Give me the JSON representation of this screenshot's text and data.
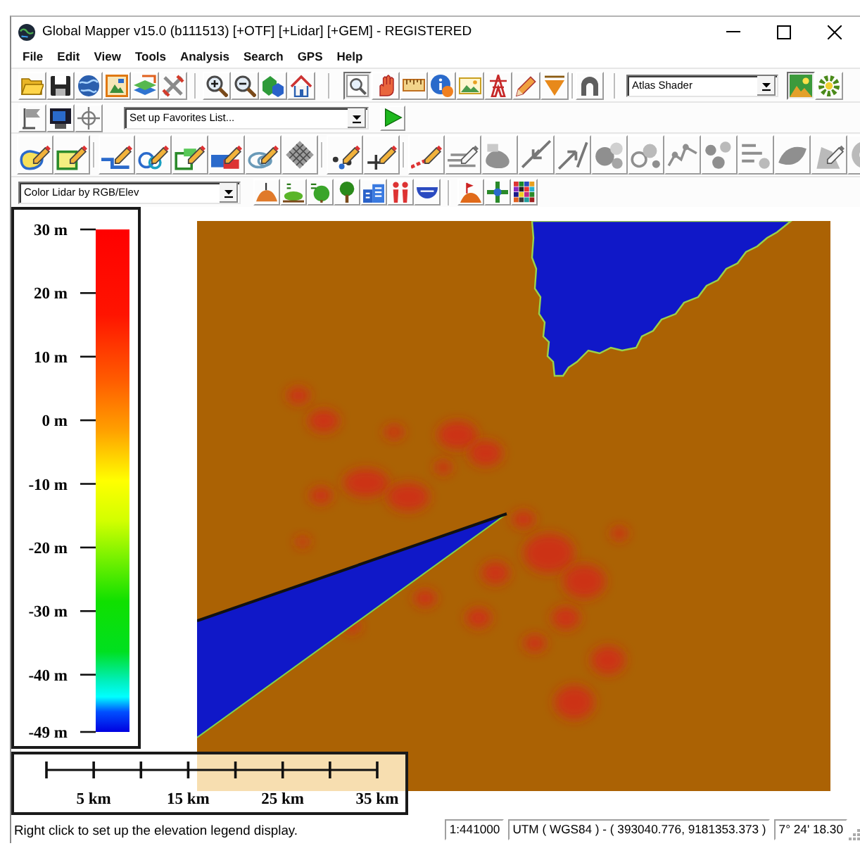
{
  "window": {
    "title": "Global Mapper v15.0 (b111513) [+OTF] [+Lidar] [+GEM] - REGISTERED"
  },
  "menu": [
    "File",
    "Edit",
    "View",
    "Tools",
    "Analysis",
    "Search",
    "GPS",
    "Help"
  ],
  "toolbar_1": {
    "groups": [
      {
        "buttons": [
          {
            "pressed": false
          },
          {
            "pressed": false
          },
          {
            "pressed": false
          },
          {
            "pressed": false
          },
          {
            "pressed": false
          },
          {
            "pressed": false
          }
        ]
      },
      {
        "buttons": [
          {
            "pressed": false
          },
          {
            "pressed": false
          },
          {
            "pressed": false
          },
          {
            "pressed": false
          }
        ]
      },
      {
        "buttons": [
          {
            "pressed": true
          },
          {
            "pressed": false
          },
          {
            "pressed": false
          },
          {
            "pressed": false
          },
          {
            "pressed": false
          },
          {
            "pressed": false
          },
          {
            "pressed": false
          },
          {
            "pressed": false
          }
        ]
      },
      {
        "buttons": [
          {
            "pressed": false
          }
        ]
      }
    ],
    "shader_select": {
      "value": "Atlas Shader"
    },
    "shader_buttons": [
      {
        "pressed": true
      },
      {
        "pressed": false
      }
    ]
  },
  "toolbar_2": {
    "buttons": [
      {
        "disabled": false
      },
      {
        "disabled": false
      },
      {
        "disabled": true
      }
    ],
    "favorites_select": {
      "value": "Set up Favorites List..."
    }
  },
  "toolbar_3": {
    "groups": [
      {
        "buttons": [
          {
            "disabled": false
          },
          {
            "disabled": false
          }
        ]
      },
      {
        "buttons": [
          {
            "disabled": false
          },
          {
            "disabled": false
          },
          {
            "disabled": false
          },
          {
            "disabled": false
          },
          {
            "disabled": false
          },
          {
            "disabled": false
          }
        ]
      },
      {
        "buttons": [
          {
            "disabled": false
          },
          {
            "disabled": false
          }
        ]
      },
      {
        "buttons": [
          {
            "disabled": false
          },
          {
            "disabled": true
          },
          {
            "disabled": true
          },
          {
            "disabled": true
          },
          {
            "disabled": true
          },
          {
            "disabled": true
          },
          {
            "disabled": true
          },
          {
            "disabled": true
          },
          {
            "disabled": true
          },
          {
            "disabled": true
          },
          {
            "disabled": true
          },
          {
            "disabled": true
          },
          {
            "disabled": true
          }
        ]
      }
    ]
  },
  "toolbar_4": {
    "lidar_select": {
      "value": "Color Lidar by RGB/Elev"
    }
  },
  "legend": {
    "ticks": [
      "30 m",
      "20 m",
      "10 m",
      "0 m",
      "-10 m",
      "-20 m",
      "-30 m",
      "-40 m",
      "-49 m"
    ]
  },
  "scale_bar": {
    "labels": [
      "5 km",
      "15 km",
      "25 km",
      "35 km"
    ]
  },
  "status_bar": {
    "hint": "Right click to set up the elevation legend display.",
    "scale": "1:441000",
    "coordinates": "UTM ( WGS84 ) - ( 393040.776, 9181353.373 )",
    "position": "7° 24' 18.30"
  }
}
